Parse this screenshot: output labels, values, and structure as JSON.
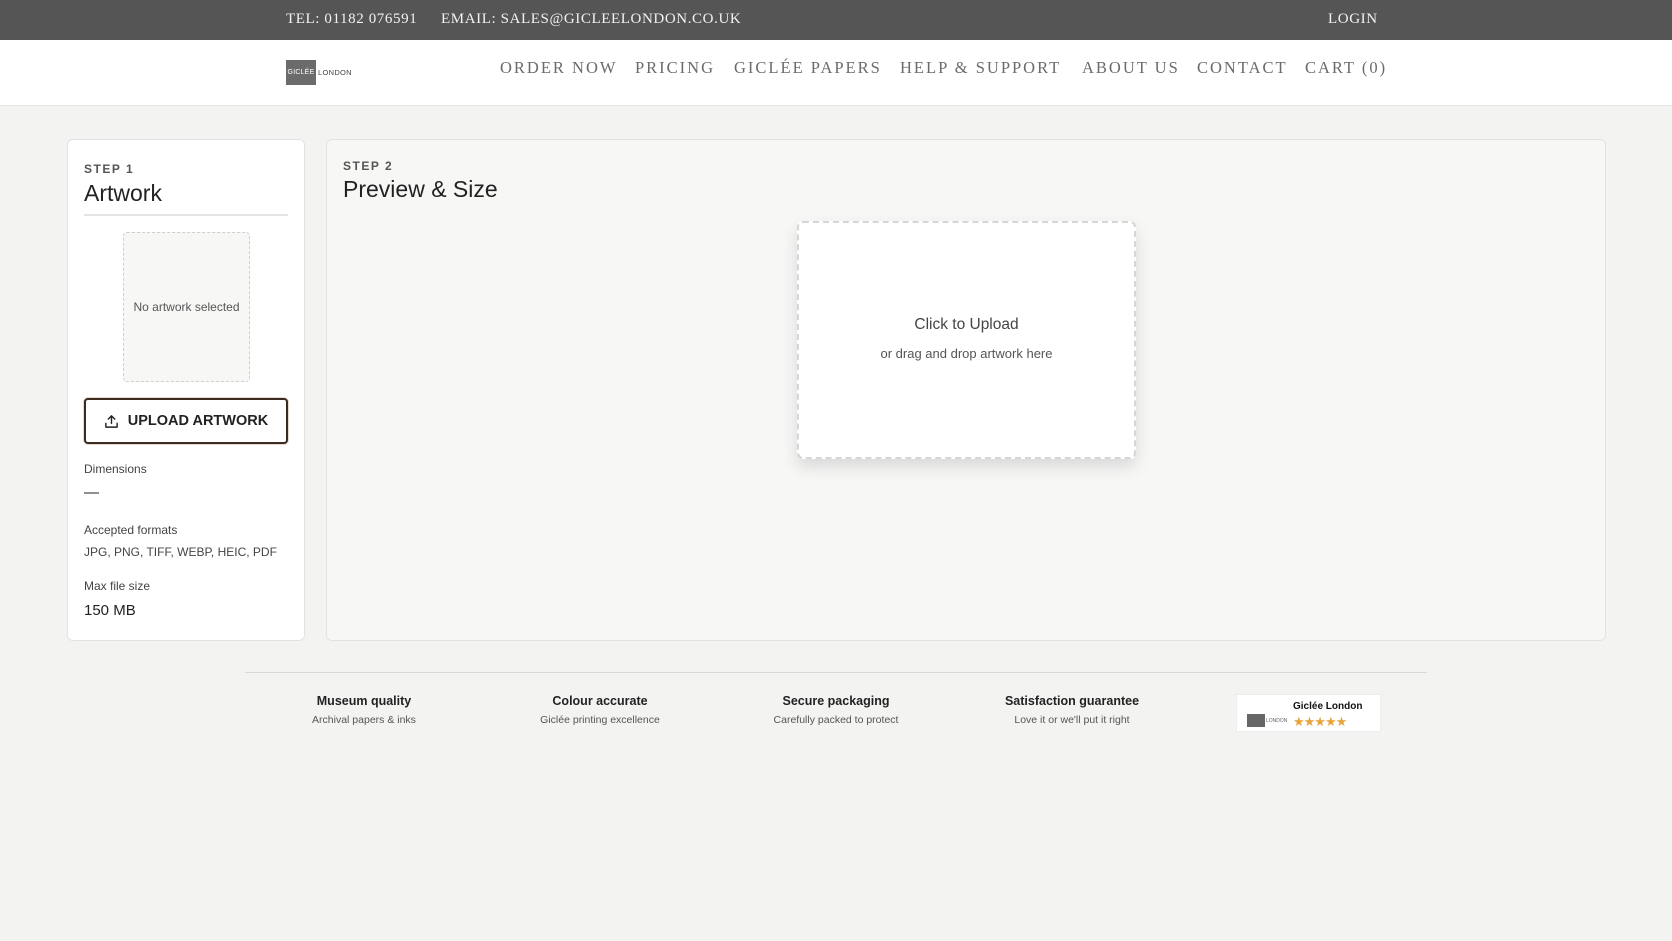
{
  "topbar": {
    "tel": "TEL: 01182 076591",
    "email": "EMAIL: SALES@GICLEELONDON.CO.UK",
    "login": "LOGIN"
  },
  "header": {
    "logo_mark": "GICLÉE",
    "logo_word": "LONDON",
    "nav": [
      {
        "label": "ORDER NOW"
      },
      {
        "label": "PRICING"
      },
      {
        "label": "GICLÉE PAPERS"
      },
      {
        "label": "HELP & SUPPORT"
      },
      {
        "label": "ABOUT US"
      },
      {
        "label": "CONTACT"
      },
      {
        "label": "CART (0)"
      }
    ]
  },
  "step1": {
    "step": "STEP 1",
    "title": "Artwork",
    "placeholder": "No artwork selected",
    "upload_button": "UPLOAD ARTWORK",
    "dimensions_label": "Dimensions",
    "dimensions_value": "—",
    "formats_label": "Accepted formats",
    "formats_value": "JPG, PNG, TIFF, WEBP, HEIC, PDF",
    "maxsize_label": "Max file size",
    "maxsize_value": "150 MB"
  },
  "step2": {
    "step": "STEP 2",
    "title": "Preview & Size",
    "drop_main": "Click to Upload",
    "drop_sub": "or drag and drop artwork here"
  },
  "features": [
    {
      "title": "Museum quality",
      "sub": "Archival papers & inks"
    },
    {
      "title": "Colour accurate",
      "sub": "Giclée printing excellence"
    },
    {
      "title": "Secure packaging",
      "sub": "Carefully packed to protect"
    },
    {
      "title": "Satisfaction guarantee",
      "sub": "Love it or we'll put it right"
    }
  ],
  "review_badge": {
    "name": "Giclée London",
    "rating": 4.5,
    "stars": "★★★★★",
    "star_color": "#e8a33b"
  },
  "colors": {
    "topbar_bg": "#555555",
    "page_bg": "#f3f3f2",
    "upload_border": "#3a2b22"
  }
}
